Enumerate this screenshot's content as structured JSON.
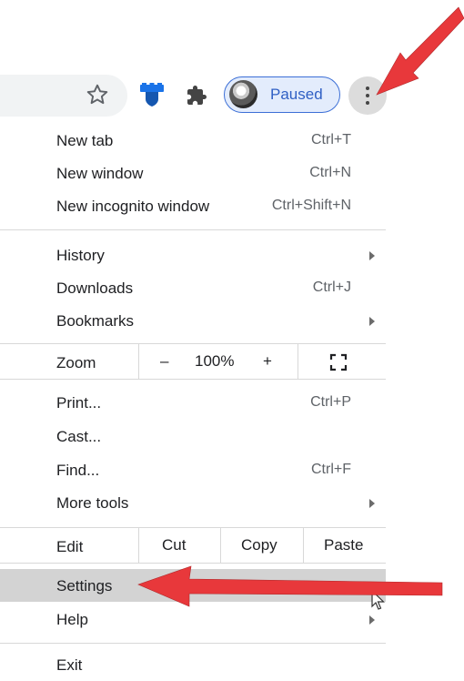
{
  "toolbar": {
    "profile_status": "Paused"
  },
  "menu": {
    "group1": [
      {
        "label": "New tab",
        "shortcut": "Ctrl+T"
      },
      {
        "label": "New window",
        "shortcut": "Ctrl+N"
      },
      {
        "label": "New incognito window",
        "shortcut": "Ctrl+Shift+N"
      }
    ],
    "group2": [
      {
        "label": "History",
        "shortcut": ""
      },
      {
        "label": "Downloads",
        "shortcut": "Ctrl+J"
      },
      {
        "label": "Bookmarks",
        "shortcut": ""
      }
    ],
    "zoom": {
      "label": "Zoom",
      "minus": "–",
      "level": "100%",
      "plus": "+"
    },
    "group3": [
      {
        "label": "Print...",
        "shortcut": "Ctrl+P"
      },
      {
        "label": "Cast...",
        "shortcut": ""
      },
      {
        "label": "Find...",
        "shortcut": "Ctrl+F"
      },
      {
        "label": "More tools",
        "shortcut": ""
      }
    ],
    "edit": {
      "label": "Edit",
      "cut": "Cut",
      "copy": "Copy",
      "paste": "Paste"
    },
    "group4": [
      {
        "label": "Settings"
      },
      {
        "label": "Help"
      }
    ],
    "exit": "Exit"
  },
  "colors": {
    "annotation_arrow": "#e8383b",
    "highlight": "#d3d3d3",
    "chip_border": "#3c6fd6"
  }
}
